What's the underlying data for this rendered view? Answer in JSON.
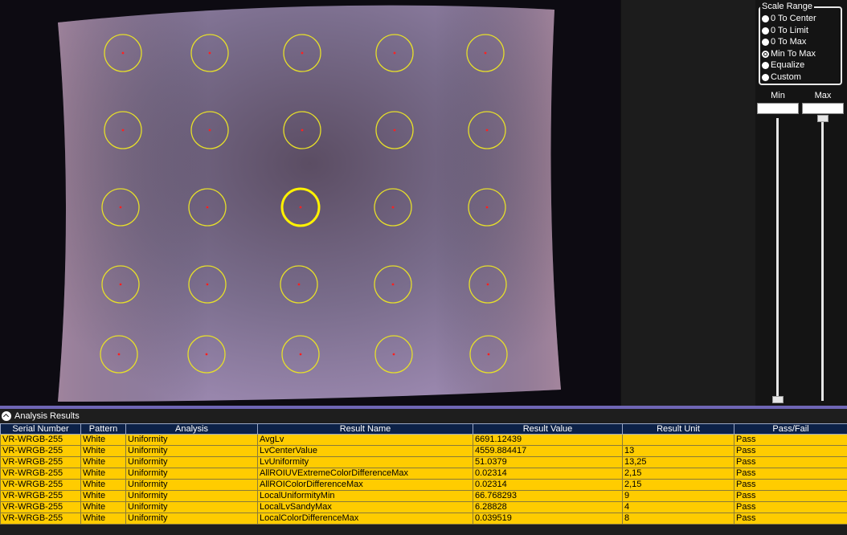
{
  "scale_range": {
    "title": "Scale Range",
    "options": [
      "0 To Center",
      "0 To Limit",
      "0 To Max",
      "Min To Max",
      "Equalize",
      "Custom"
    ],
    "selected": "Min To Max"
  },
  "range_controls": {
    "min_label": "Min",
    "max_label": "Max",
    "min_value": "",
    "max_value": ""
  },
  "results": {
    "header_label": "Analysis Results",
    "columns": [
      "Serial Number",
      "Pattern",
      "Analysis",
      "Result Name",
      "Result Value",
      "Result Unit",
      "Pass/Fail"
    ],
    "rows": [
      [
        "VR-WRGB-255",
        "White",
        "Uniformity",
        "AvgLv",
        "6691.12439",
        "",
        "Pass"
      ],
      [
        "VR-WRGB-255",
        "White",
        "Uniformity",
        "LvCenterValue",
        "4559.884417",
        "13",
        "Pass"
      ],
      [
        "VR-WRGB-255",
        "White",
        "Uniformity",
        "LvUniformity",
        "51.0379",
        "13,25",
        "Pass"
      ],
      [
        "VR-WRGB-255",
        "White",
        "Uniformity",
        "AllROIUVExtremeColorDifferenceMax",
        "0.02314",
        "2,15",
        "Pass"
      ],
      [
        "VR-WRGB-255",
        "White",
        "Uniformity",
        "AllROIColorDifferenceMax",
        "0.02314",
        "2,15",
        "Pass"
      ],
      [
        "VR-WRGB-255",
        "White",
        "Uniformity",
        "LocalUniformityMin",
        "66.768293",
        "9",
        "Pass"
      ],
      [
        "VR-WRGB-255",
        "White",
        "Uniformity",
        "LocalLvSandyMax",
        "6.28828",
        "4",
        "Pass"
      ],
      [
        "VR-WRGB-255",
        "White",
        "Uniformity",
        "LocalColorDifferenceMax",
        "0.039519",
        "8",
        "Pass"
      ]
    ]
  },
  "colors": {
    "roi_circle": "#e6df2a",
    "roi_center": "#ff2020",
    "row_fill": "#ffcc00",
    "header_fill": "#0c2147",
    "splitter": "#6f66b5"
  }
}
